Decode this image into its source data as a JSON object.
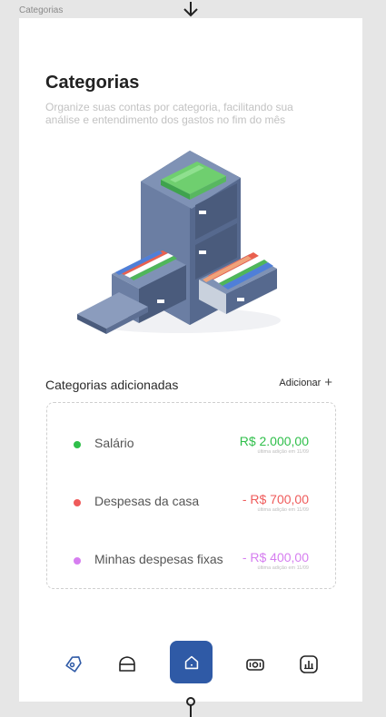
{
  "frame": {
    "label": "Categorias"
  },
  "header": {
    "title": "Categorias",
    "subtitle": "Organize suas contas por categoria, facilitando sua análise e entendimento dos gastos no fim do mês"
  },
  "section": {
    "title": "Categorias adicionadas",
    "add_label": "Adicionar",
    "add_icon": "+"
  },
  "categories": [
    {
      "name": "Salário",
      "value": "R$ 2.000,00",
      "meta": "última adição em 11/09",
      "color": "#2fbf4a"
    },
    {
      "name": "Despesas da casa",
      "value": "- R$ 700,00",
      "meta": "última adição em 11/09",
      "color": "#ef5b5b"
    },
    {
      "name": "Minhas despesas fixas",
      "value": "- R$ 400,00",
      "meta": "última adição em 11/09",
      "color": "#d67ef0"
    }
  ],
  "nav": {
    "items": [
      "tag-icon",
      "wallet-icon",
      "home-icon",
      "money-icon",
      "chart-icon"
    ],
    "active": "home-icon",
    "accent": "#2f5aa6"
  }
}
